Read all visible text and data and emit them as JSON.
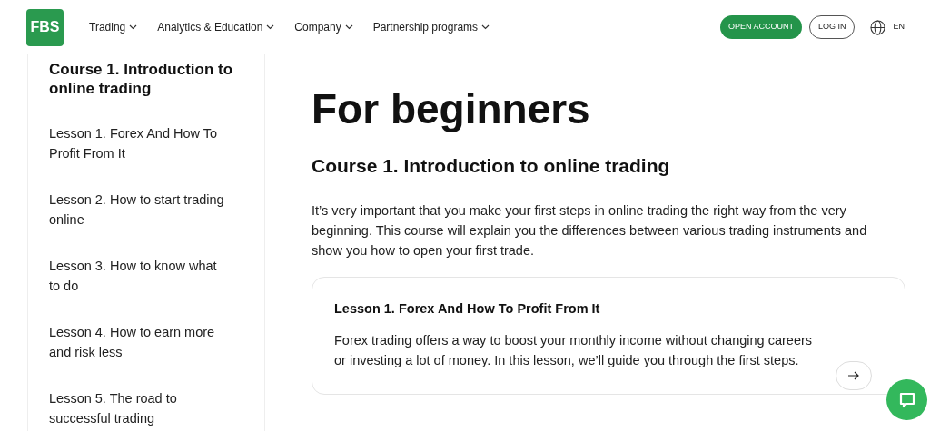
{
  "header": {
    "logo": "FBS",
    "nav": [
      {
        "label": "Trading"
      },
      {
        "label": "Analytics & Education"
      },
      {
        "label": "Company"
      },
      {
        "label": "Partnership programs"
      }
    ],
    "open_account": "OPEN ACCOUNT",
    "log_in": "LOG IN",
    "language": "EN"
  },
  "sidebar": {
    "course_title": "Course 1. Introduction to online trading",
    "lessons": [
      {
        "label": "Lesson 1. Forex And How To Profit From It"
      },
      {
        "label": "Lesson 2. How to start trading online"
      },
      {
        "label": "Lesson 3. How to know what to do"
      },
      {
        "label": "Lesson 4. How to earn more and risk less"
      },
      {
        "label": "Lesson 5. The road to successful trading"
      }
    ]
  },
  "main": {
    "title": "For beginners",
    "course_title": "Course 1. Introduction to online trading",
    "description": "It’s very important that you make your first steps in online trading the right way from the very beginning. This course will explain you the differences between various trading instruments and show you how to open your first trade.",
    "lesson_card": {
      "title": "Lesson 1. Forex And How To Profit From It",
      "text": "Forex trading offers a way to boost your monthly income without changing careers or investing a lot of money. In this lesson, we’ll guide you through the first steps."
    }
  }
}
